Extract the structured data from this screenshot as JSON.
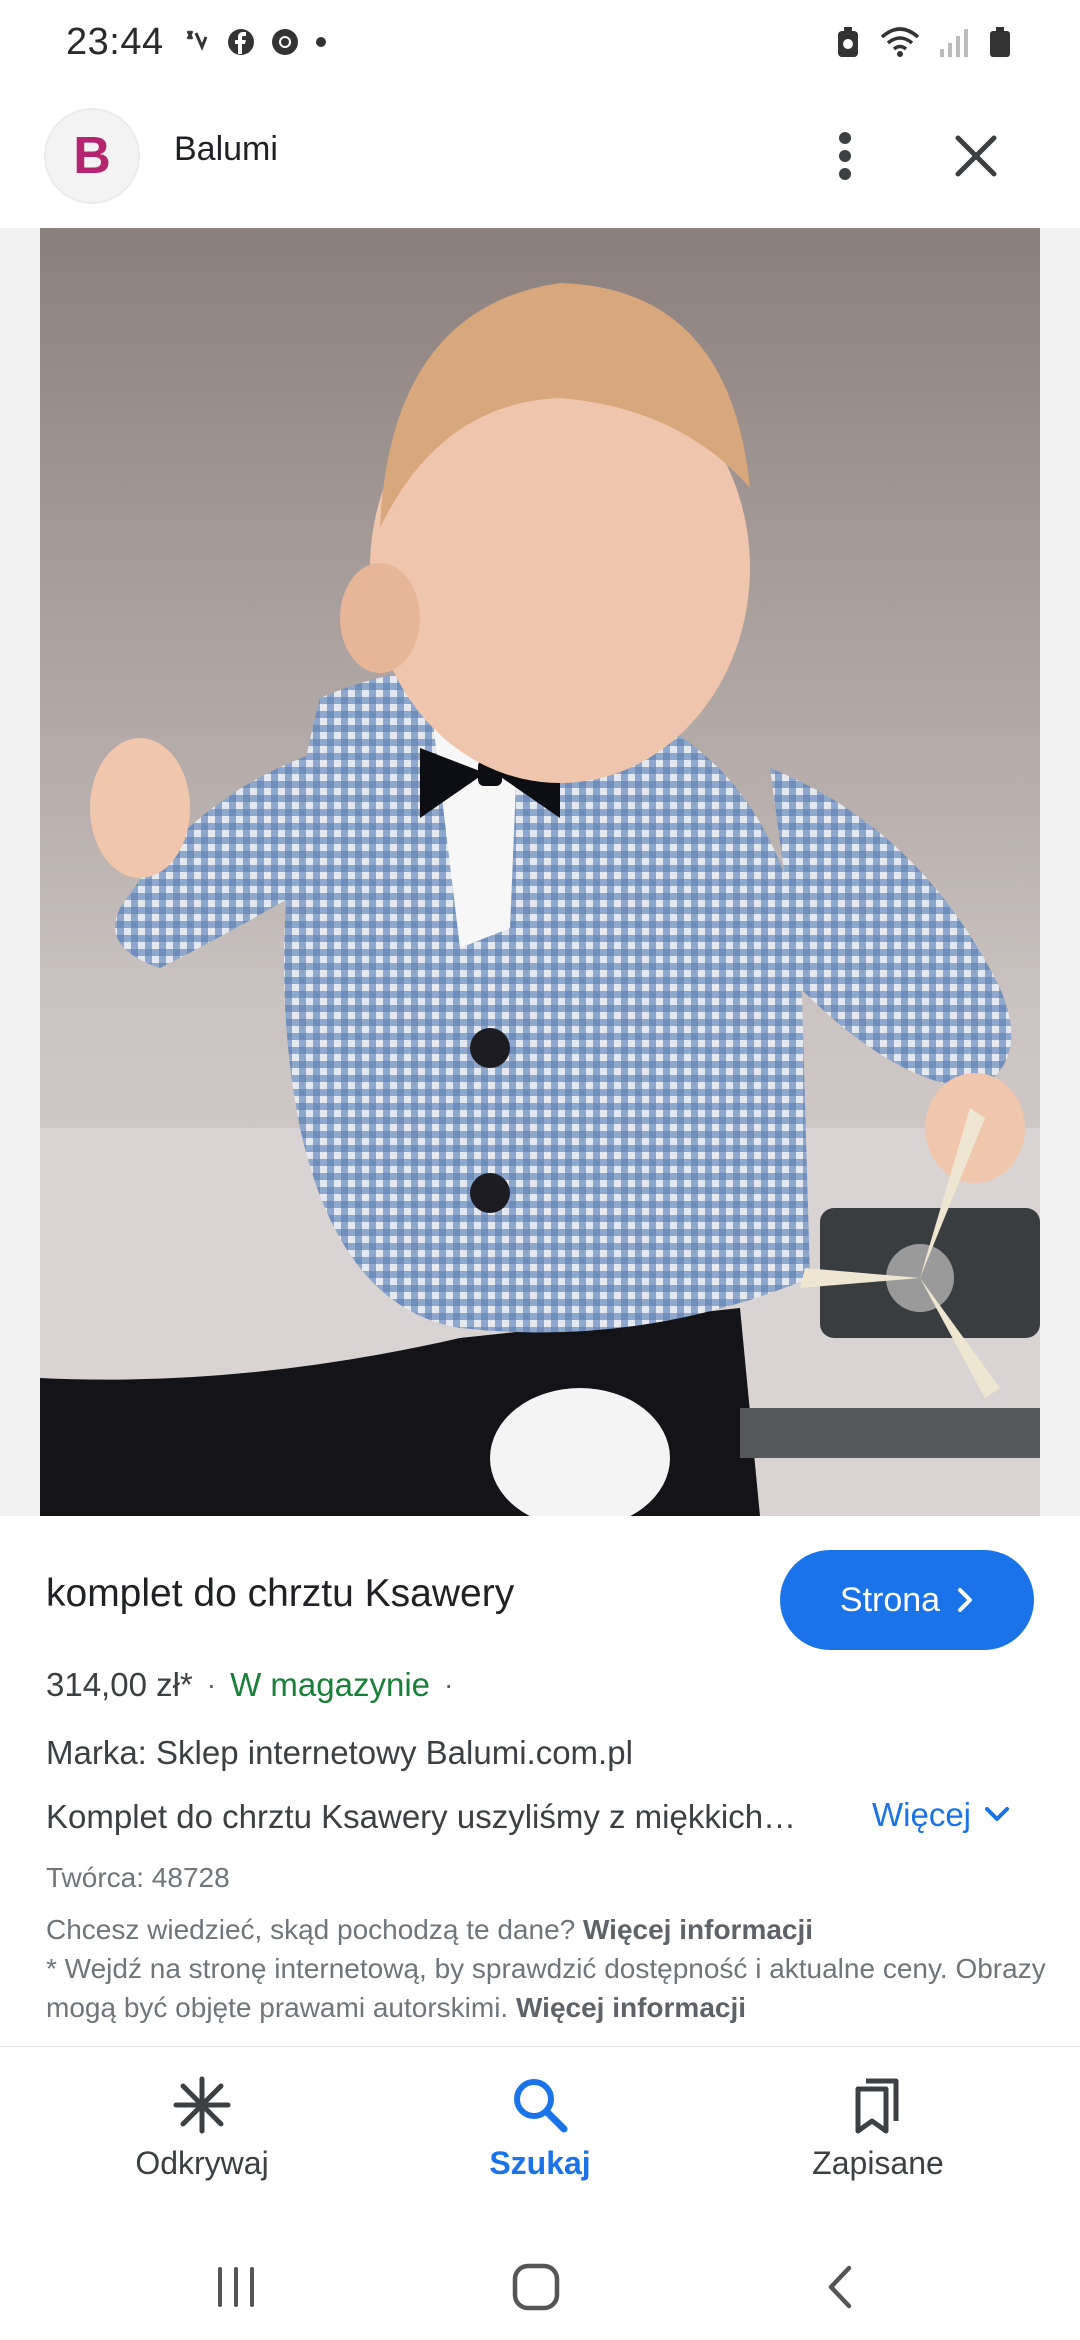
{
  "status_bar": {
    "time": "23:44",
    "notification_icons": [
      "missed-call-icon",
      "facebook-icon",
      "chrome-icon",
      "dot-icon"
    ],
    "system_icons": [
      "battery-saver-icon",
      "wifi-icon",
      "signal-icon",
      "battery-icon"
    ]
  },
  "app_bar": {
    "logo_letter": "B",
    "site_name": "Balumi",
    "menu_icon": "more-vert-icon",
    "close_icon": "close-icon"
  },
  "image": {
    "description_icon": "google-lens-icon"
  },
  "product": {
    "title": "komplet do chrztu Ksawery",
    "site_button_label": "Strona",
    "price": "314,00 zł*",
    "separator": "·",
    "stock": "W magazynie",
    "brand": "Marka: Sklep internetowy Balumi.com.pl",
    "description": "Komplet do chrztu Ksawery uszyliśmy z miękkich…",
    "more_label": "Więcej",
    "creator": "Twórca: 48728",
    "info_question": "Chcesz wiedzieć, skąd pochodzą te dane?",
    "info_link": "Więcej informacji",
    "disclaimer": "* Wejdź na stronę internetową, by sprawdzić dostępność i aktualne ceny. Obrazy mogą być objęte prawami autorskimi.",
    "disclaimer_link": "Więcej informacji"
  },
  "bottom_nav": {
    "items": [
      {
        "label": "Odkrywaj",
        "icon": "asterisk-icon",
        "active": false
      },
      {
        "label": "Szukaj",
        "icon": "search-icon",
        "active": true
      },
      {
        "label": "Zapisane",
        "icon": "bookmarks-icon",
        "active": false
      }
    ]
  },
  "colors": {
    "accent": "#1a73e8",
    "stock_green": "#188038",
    "logo_magenta": "#b5246e"
  }
}
